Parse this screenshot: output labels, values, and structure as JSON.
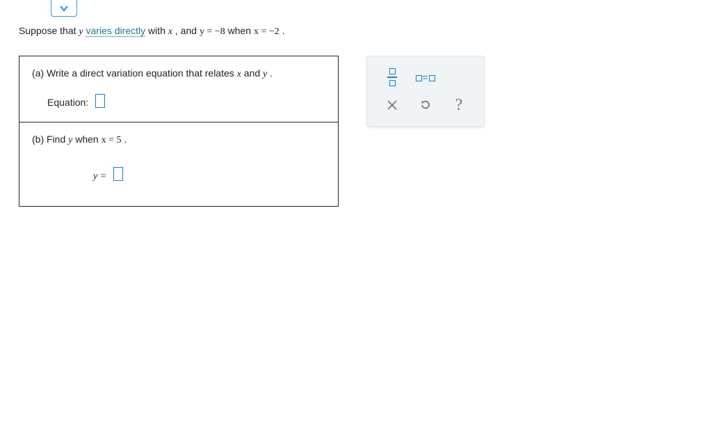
{
  "problem": {
    "intro_prefix": "Suppose that ",
    "y": "y",
    "link_text": "varies directly",
    "with_text": " with ",
    "x": "x",
    "cond_text": ", and ",
    "eq1": "y = −8",
    "when_text": " when ",
    "eq2": "x = −2",
    "period": "."
  },
  "part_a": {
    "label_prefix": "(a) Write a direct variation equation that relates ",
    "x": "x",
    "and_text": " and ",
    "y": "y",
    "suffix": " .",
    "equation_label": "Equation:"
  },
  "part_b": {
    "label_prefix": "(b) Find ",
    "y": "y",
    "when_text": " when ",
    "cond": "x = 5",
    "suffix": " .",
    "answer_prefix": "y = "
  },
  "toolbar": {
    "fraction_tool": "fraction",
    "equation_tool": "equation",
    "clear": "×",
    "reset": "↺",
    "help": "?"
  }
}
